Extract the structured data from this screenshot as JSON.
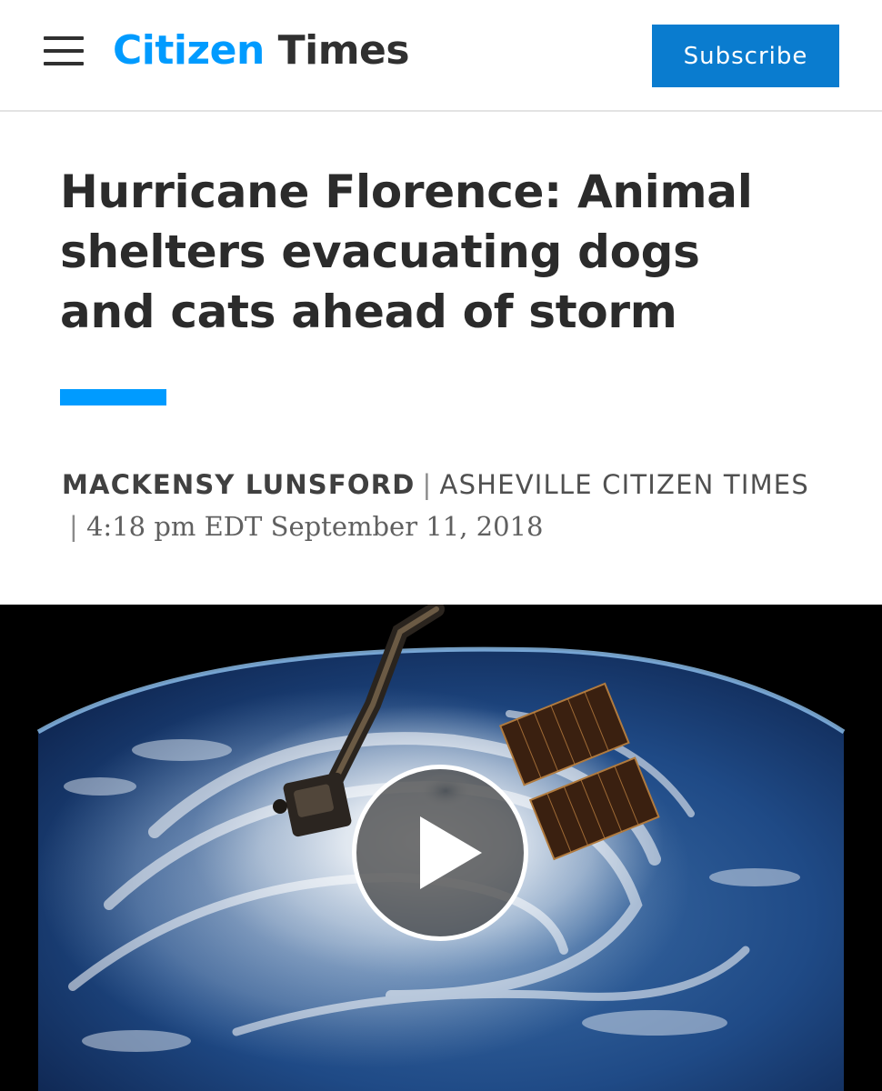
{
  "header": {
    "logo_part1": "Citizen",
    "logo_part2": "Times",
    "subscribe_label": "Subscribe",
    "menu_icon": "hamburger-menu-icon",
    "accent_color": "#009bff",
    "button_color": "#0a7ccf"
  },
  "article": {
    "headline": "Hurricane Florence: Animal shelters evacuating dogs and cats ahead of storm",
    "author": "MACKENSY LUNSFORD",
    "separator": "|",
    "publication": "ASHEVILLE CITIZEN TIMES",
    "timestamp": "4:18 pm EDT September 11, 2018"
  },
  "video": {
    "play_icon": "play-icon"
  }
}
